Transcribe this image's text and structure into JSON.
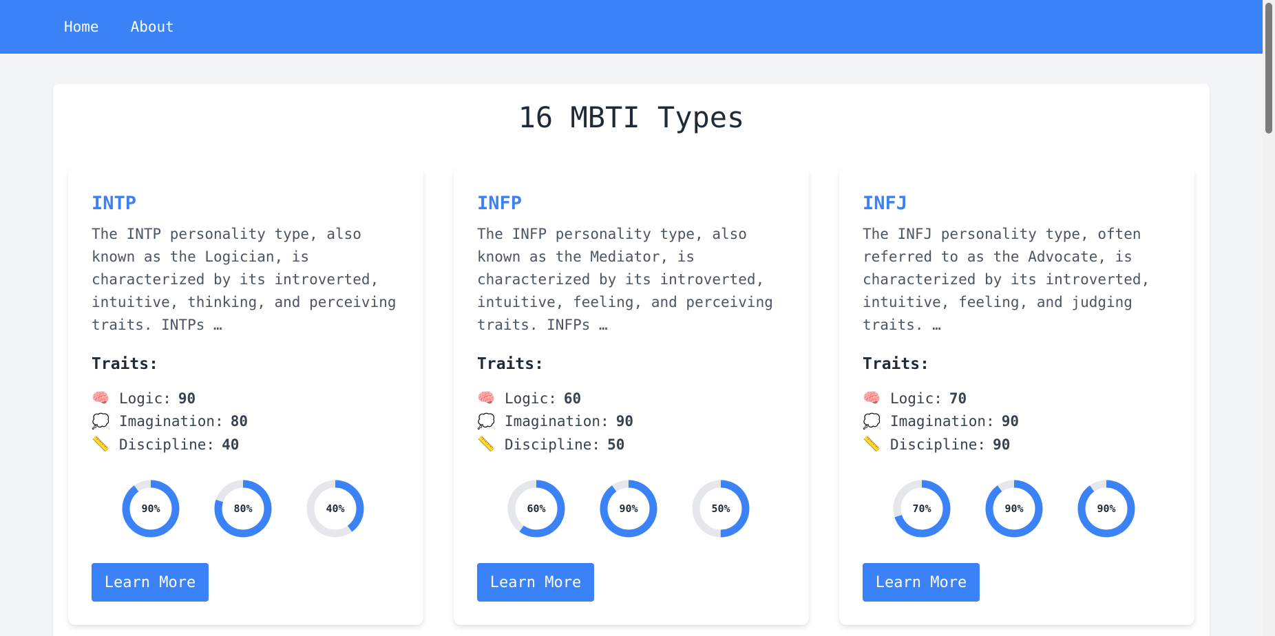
{
  "nav": {
    "links": [
      "Home",
      "About"
    ]
  },
  "page": {
    "title": "16 MBTI Types"
  },
  "colors": {
    "accent": "#3b82f6",
    "ring_track": "#e5e7eb"
  },
  "cards": [
    {
      "title": "INTP",
      "description": "The INTP personality type, also known as the Logician, is characterized by its introverted, intuitive, thinking, and perceiving traits. INTPs …",
      "traits_heading": "Traits:",
      "traits": [
        {
          "icon": "brain-icon",
          "emoji": "🧠",
          "label": "Logic:",
          "value": "90"
        },
        {
          "icon": "thought-bubble-icon",
          "emoji": "💭",
          "label": "Imagination:",
          "value": "80"
        },
        {
          "icon": "ruler-icon",
          "emoji": "📏",
          "label": "Discipline:",
          "value": "40"
        }
      ],
      "rings": [
        {
          "percent": 90,
          "label": "90%"
        },
        {
          "percent": 80,
          "label": "80%"
        },
        {
          "percent": 40,
          "label": "40%"
        }
      ],
      "button": "Learn More"
    },
    {
      "title": "INFP",
      "description": "The INFP personality type, also known as the Mediator, is characterized by its introverted, intuitive, feeling, and perceiving traits. INFPs …",
      "traits_heading": "Traits:",
      "traits": [
        {
          "icon": "brain-icon",
          "emoji": "🧠",
          "label": "Logic:",
          "value": "60"
        },
        {
          "icon": "thought-bubble-icon",
          "emoji": "💭",
          "label": "Imagination:",
          "value": "90"
        },
        {
          "icon": "ruler-icon",
          "emoji": "📏",
          "label": "Discipline:",
          "value": "50"
        }
      ],
      "rings": [
        {
          "percent": 60,
          "label": "60%"
        },
        {
          "percent": 90,
          "label": "90%"
        },
        {
          "percent": 50,
          "label": "50%"
        }
      ],
      "button": "Learn More"
    },
    {
      "title": "INFJ",
      "description": "The INFJ personality type, often referred to as the Advocate, is characterized by its introverted, intuitive, feeling, and judging traits. …",
      "traits_heading": "Traits:",
      "traits": [
        {
          "icon": "brain-icon",
          "emoji": "🧠",
          "label": "Logic:",
          "value": "70"
        },
        {
          "icon": "thought-bubble-icon",
          "emoji": "💭",
          "label": "Imagination:",
          "value": "90"
        },
        {
          "icon": "ruler-icon",
          "emoji": "📏",
          "label": "Discipline:",
          "value": "90"
        }
      ],
      "rings": [
        {
          "percent": 70,
          "label": "70%"
        },
        {
          "percent": 90,
          "label": "90%"
        },
        {
          "percent": 90,
          "label": "90%"
        }
      ],
      "button": "Learn More"
    }
  ]
}
